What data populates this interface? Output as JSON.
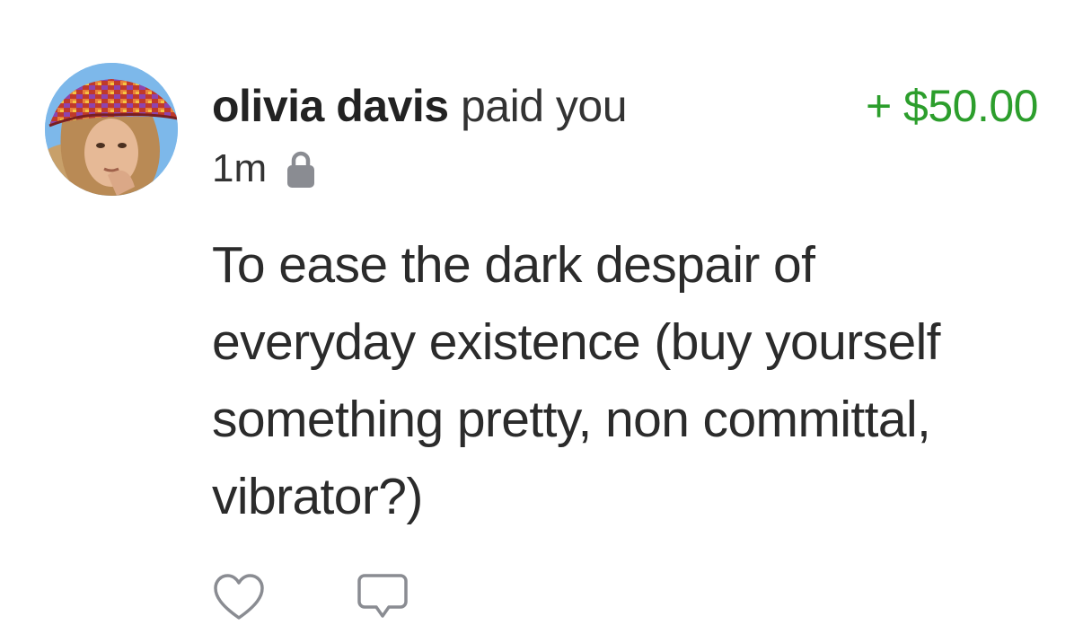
{
  "transaction": {
    "sender_name": "olivia davis",
    "action_text": "paid you",
    "amount": "+ $50.00",
    "amount_color": "#2c9e2c",
    "time_ago": "1m",
    "privacy_icon": "lock-icon",
    "message": "To ease the dark despair of everyday existence (buy yourself something pretty, non committal, vibrator?)"
  },
  "actions": [
    {
      "name": "like",
      "icon": "heart-icon"
    },
    {
      "name": "comment",
      "icon": "comment-icon"
    }
  ]
}
